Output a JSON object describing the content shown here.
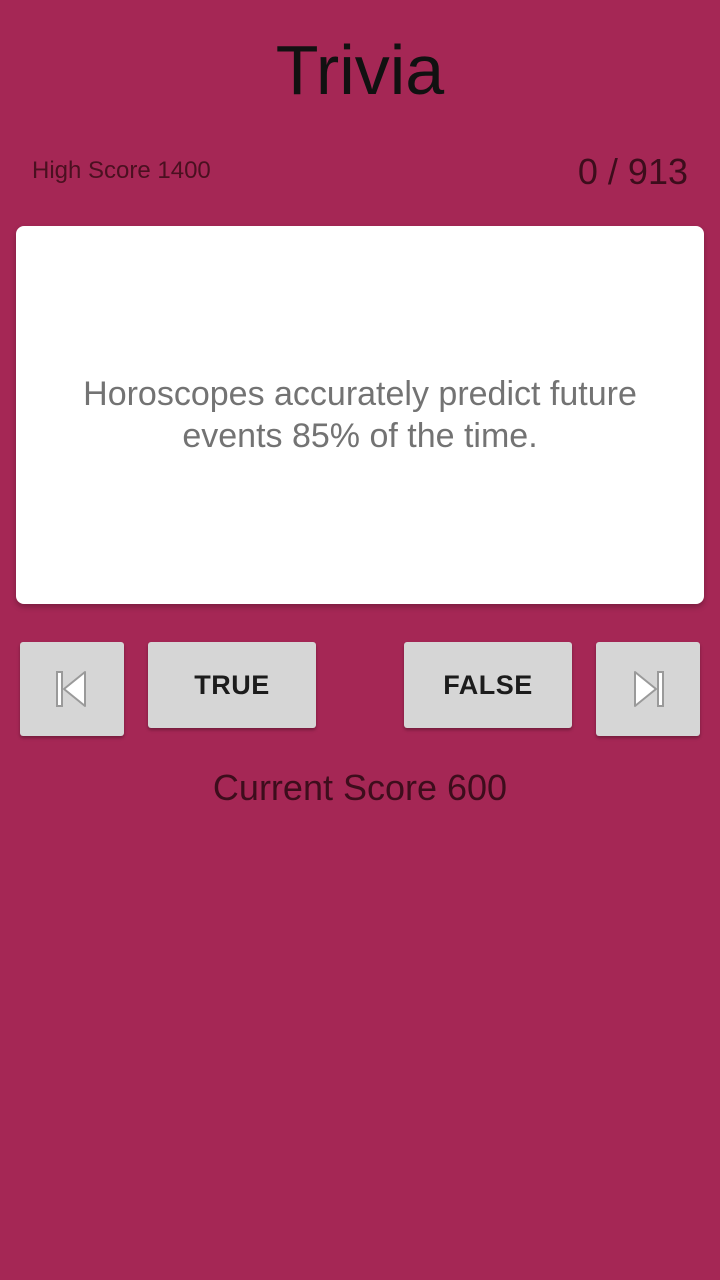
{
  "header": {
    "title": "Trivia"
  },
  "stats": {
    "high_score": "High Score 1400",
    "progress": "0 / 913"
  },
  "question_card": {
    "text": "Horoscopes accurately predict future events 85% of the time."
  },
  "controls": {
    "prev_icon": "skip-previous-icon",
    "true_label": "TRUE",
    "false_label": "FALSE",
    "next_icon": "skip-next-icon"
  },
  "footer": {
    "current_score": "Current Score 600"
  },
  "colors": {
    "background": "#a52755",
    "card": "#ffffff",
    "button": "#d6d6d6"
  }
}
